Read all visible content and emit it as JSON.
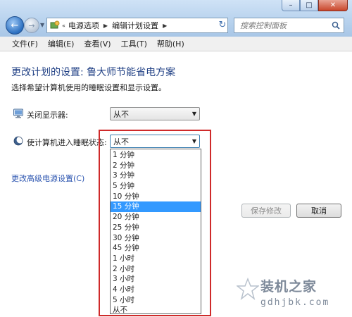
{
  "window": {
    "minimize": "–",
    "maximize": "□",
    "close": "✕"
  },
  "navigation": {
    "back_icon": "back-arrow-icon",
    "forward_icon": "forward-arrow-icon",
    "breadcrumb_prefix": "«",
    "breadcrumb": [
      "电源选项",
      "编辑计划设置"
    ],
    "refresh_icon": "refresh-icon"
  },
  "search": {
    "placeholder": "搜索控制面板"
  },
  "menu": {
    "items": [
      "文件(F)",
      "编辑(E)",
      "查看(V)",
      "工具(T)",
      "帮助(H)"
    ]
  },
  "page": {
    "title": "更改计划的设置: 鲁大师节能省电方案",
    "subtitle": "选择希望计算机使用的睡眠设置和显示设置。"
  },
  "settings": {
    "display_off": {
      "label": "关闭显示器:",
      "value": "从不",
      "icon": "monitor-icon"
    },
    "sleep": {
      "label": "使计算机进入睡眠状态:",
      "value": "从不",
      "icon": "moon-icon",
      "options": [
        "1 分钟",
        "2 分钟",
        "3 分钟",
        "5 分钟",
        "10 分钟",
        "15 分钟",
        "20 分钟",
        "25 分钟",
        "30 分钟",
        "45 分钟",
        "1 小时",
        "2 小时",
        "3 小时",
        "4 小时",
        "5 小时",
        "从不"
      ],
      "highlighted": "15 分钟"
    }
  },
  "advanced_link": "更改高级电源设置(C)",
  "buttons": {
    "save": "保存修改",
    "cancel": "取消"
  },
  "watermark": {
    "title": "装机之家",
    "url": "gdhjbk.com"
  },
  "colors": {
    "title_text": "#1f3f84",
    "link": "#2c55b0",
    "selection": "#3399ff",
    "highlight_border": "#cf2a2a"
  }
}
